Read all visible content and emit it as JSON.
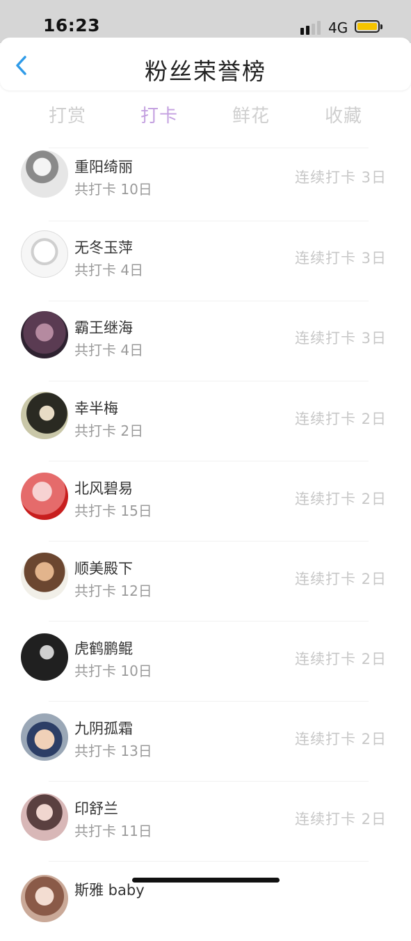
{
  "status": {
    "time": "16:23",
    "network": "4G"
  },
  "header": {
    "title": "粉丝荣誉榜",
    "back_icon": "chevron-left-icon"
  },
  "tabs": [
    {
      "label": "打赏",
      "active": false
    },
    {
      "label": "打卡",
      "active": true
    },
    {
      "label": "鲜花",
      "active": false
    },
    {
      "label": "收藏",
      "active": false
    }
  ],
  "colors": {
    "accent": "#c4a1e0",
    "battery": "#f5c400",
    "back": "#2f9be8"
  },
  "fans": [
    {
      "name": "重阳绮丽",
      "total": "共打卡 10日",
      "streak": "连续打卡 3日"
    },
    {
      "name": "无冬玉萍",
      "total": "共打卡 4日",
      "streak": "连续打卡 3日"
    },
    {
      "name": "霸王继海",
      "total": "共打卡 4日",
      "streak": "连续打卡 3日"
    },
    {
      "name": "幸半梅",
      "total": "共打卡 2日",
      "streak": "连续打卡 2日"
    },
    {
      "name": "北风碧易",
      "total": "共打卡 15日",
      "streak": "连续打卡 2日"
    },
    {
      "name": "顺美殿下",
      "total": "共打卡 12日",
      "streak": "连续打卡 2日"
    },
    {
      "name": "虎鹤鹏鲲",
      "total": "共打卡 10日",
      "streak": "连续打卡 2日"
    },
    {
      "name": "九阴孤霜",
      "total": "共打卡 13日",
      "streak": "连续打卡 2日"
    },
    {
      "name": "印舒兰",
      "total": "共打卡 11日",
      "streak": "连续打卡 2日"
    },
    {
      "name": "斯雅 baby",
      "total": "",
      "streak": ""
    }
  ]
}
